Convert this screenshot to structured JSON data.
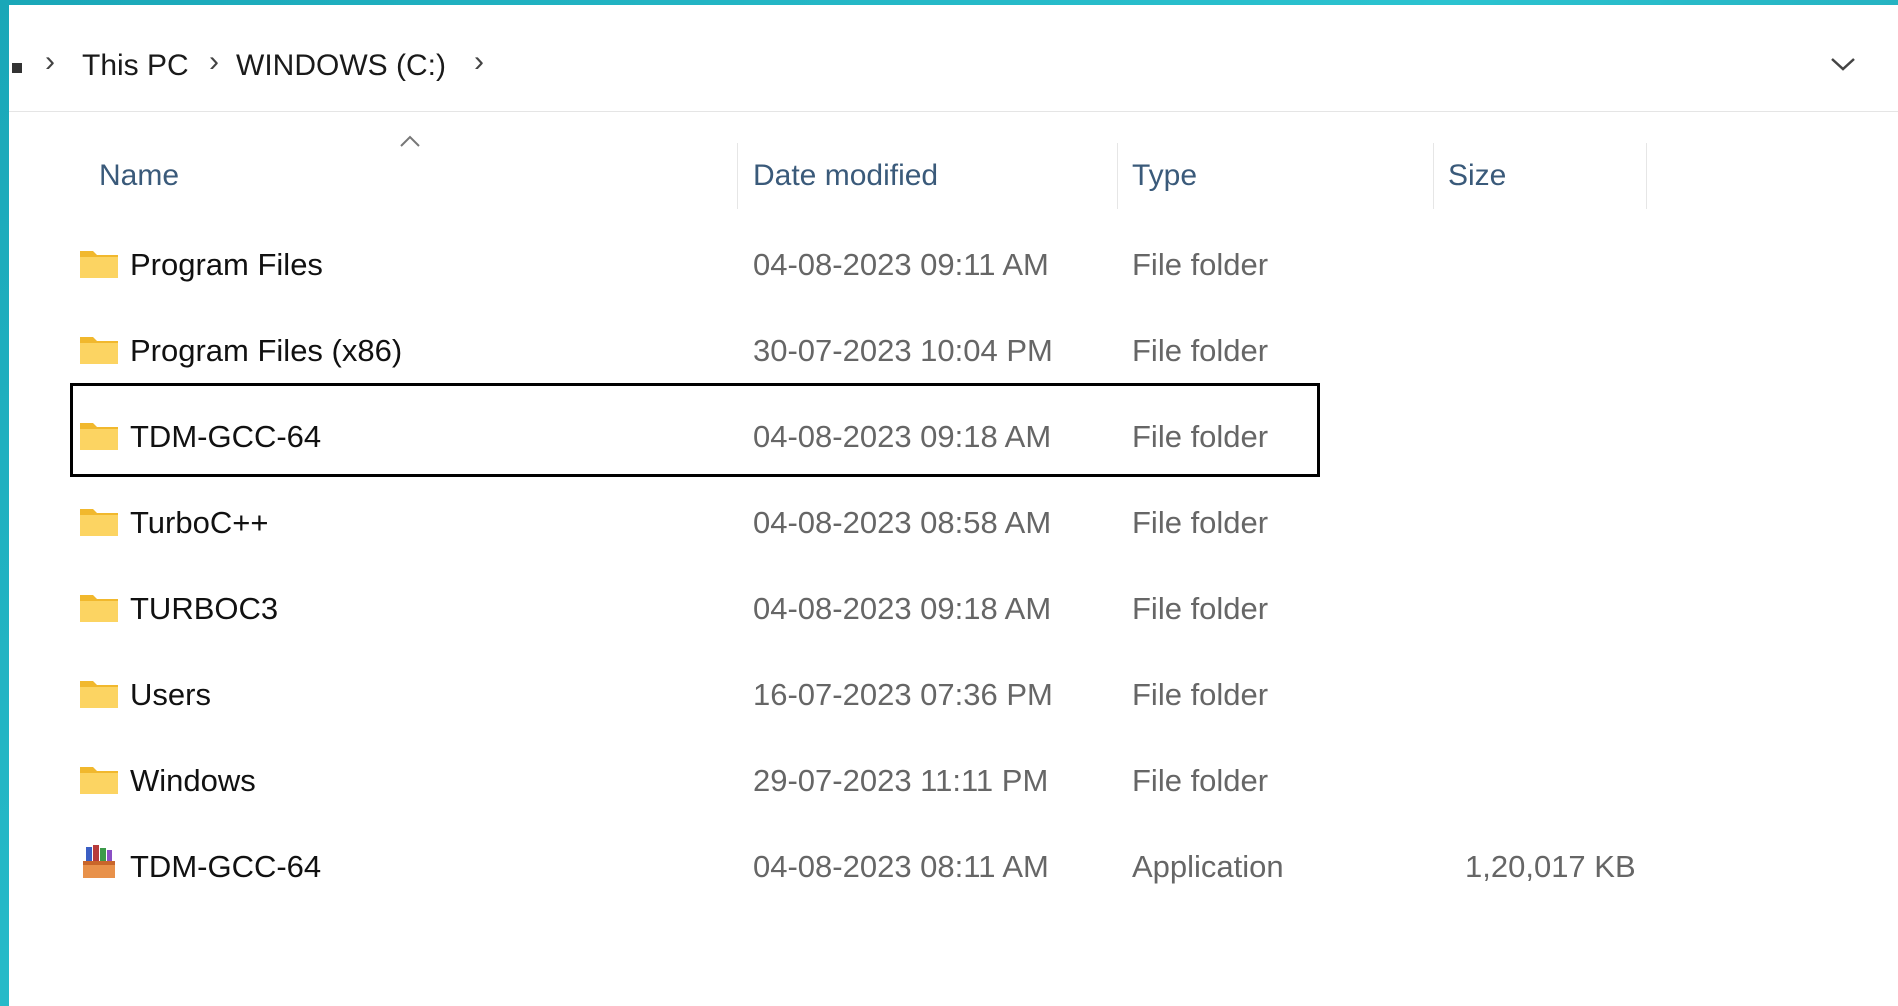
{
  "breadcrumb": {
    "items": [
      "This PC",
      "WINDOWS (C:)"
    ]
  },
  "columns": {
    "name": "Name",
    "date_modified": "Date modified",
    "type": "Type",
    "size": "Size"
  },
  "files": [
    {
      "name": "Program Files",
      "date": "04-08-2023 09:11 AM",
      "type": "File folder",
      "size": "",
      "icon": "folder-icon"
    },
    {
      "name": "Program Files (x86)",
      "date": "30-07-2023 10:04 PM",
      "type": "File folder",
      "size": "",
      "icon": "folder-icon"
    },
    {
      "name": "TDM-GCC-64",
      "date": "04-08-2023 09:18 AM",
      "type": "File folder",
      "size": "",
      "icon": "folder-icon"
    },
    {
      "name": "TurboC++",
      "date": "04-08-2023 08:58 AM",
      "type": "File folder",
      "size": "",
      "icon": "folder-icon"
    },
    {
      "name": "TURBOC3",
      "date": "04-08-2023 09:18 AM",
      "type": "File folder",
      "size": "",
      "icon": "folder-icon"
    },
    {
      "name": "Users",
      "date": "16-07-2023 07:36 PM",
      "type": "File folder",
      "size": "",
      "icon": "folder-icon"
    },
    {
      "name": "Windows",
      "date": "29-07-2023 11:11 PM",
      "type": "File folder",
      "size": "",
      "icon": "folder-icon"
    },
    {
      "name": "TDM-GCC-64",
      "date": "04-08-2023 08:11 AM",
      "type": "Application",
      "size": "1,20,017 KB",
      "icon": "installer-app-icon"
    }
  ],
  "colors": {
    "window_bg": "#ffffff",
    "header_text": "#3a5a7a",
    "folder_yellow": "#f8c940",
    "secondary_text": "#666666",
    "desktop_teal": "#2bc3d0"
  }
}
